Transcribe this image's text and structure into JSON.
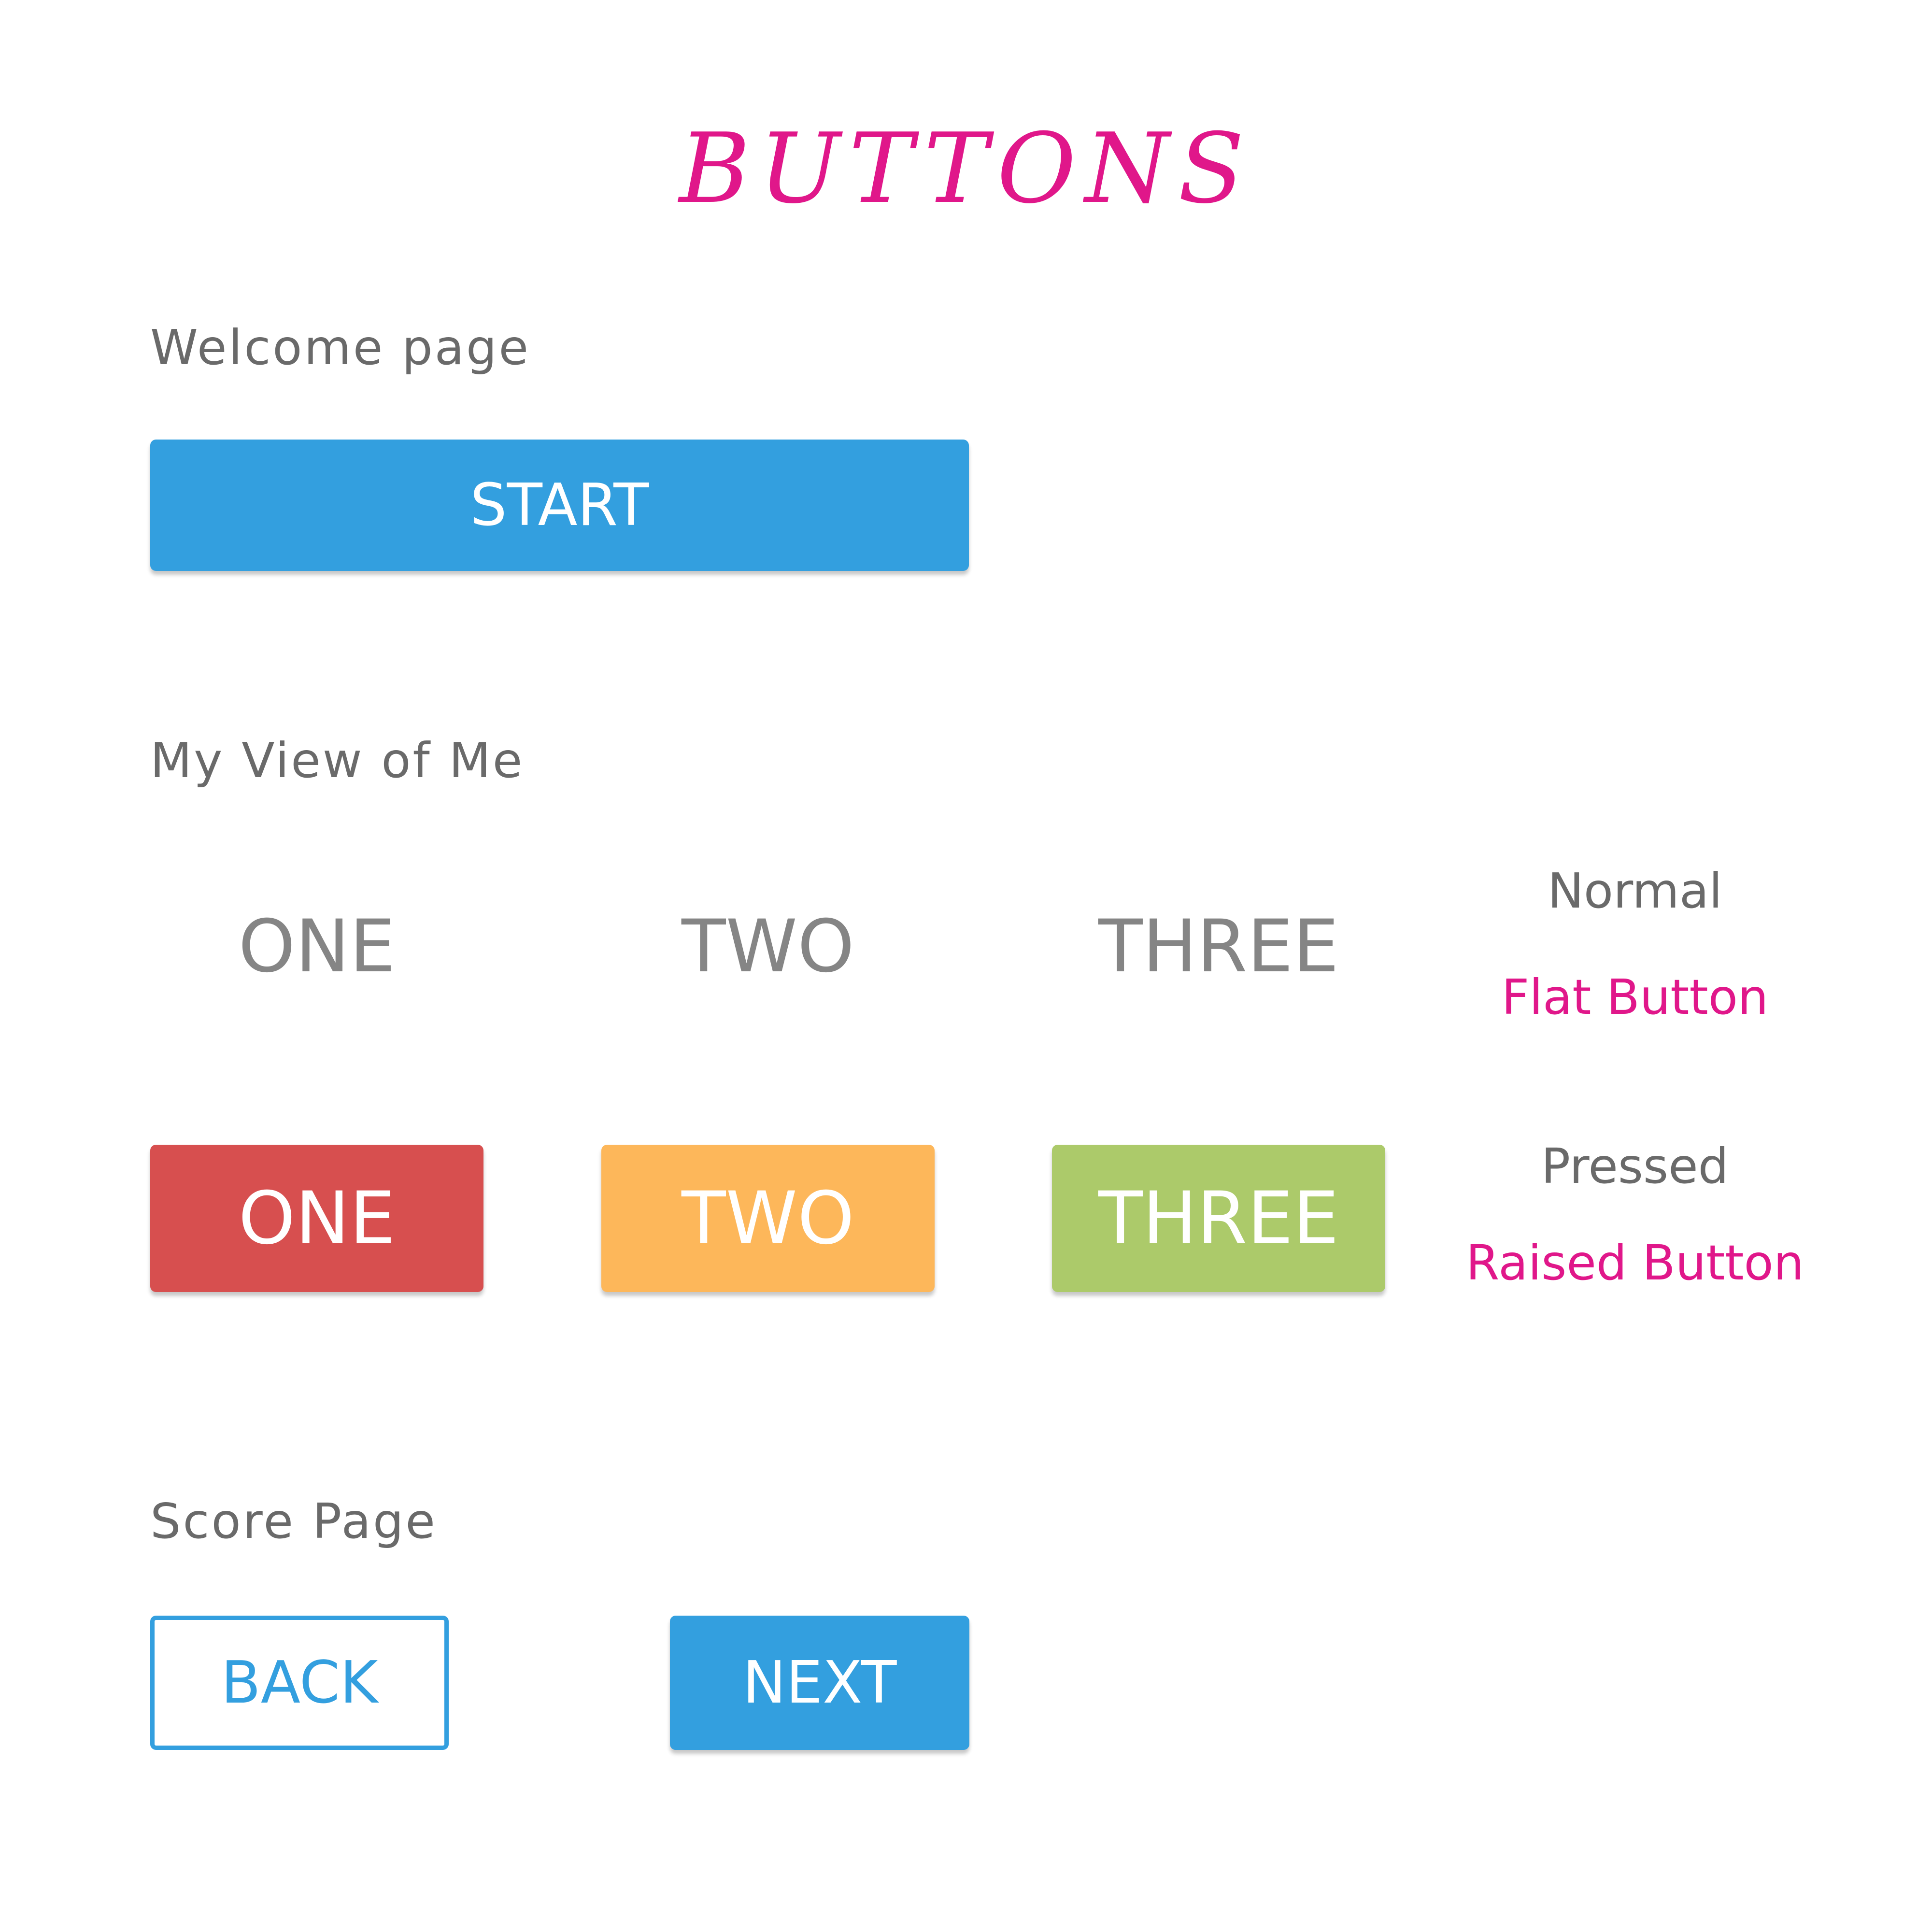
{
  "title": "BUTTONS",
  "welcome": {
    "label": "Welcome page",
    "start_button": "START"
  },
  "my_view": {
    "label": "My View of Me",
    "flat_buttons": [
      "ONE",
      "TWO",
      "THREE"
    ],
    "raised_buttons": [
      {
        "label": "ONE",
        "color": "#d74f4f"
      },
      {
        "label": "TWO",
        "color": "#fdb75a"
      },
      {
        "label": "THREE",
        "color": "#acca6a"
      }
    ],
    "legend": {
      "normal_state": "Normal",
      "normal_type": "Flat Button",
      "pressed_state": "Pressed",
      "pressed_type": "Raised Button"
    }
  },
  "score": {
    "label": "Score Page",
    "back_button": "BACK",
    "next_button": "NEXT"
  },
  "colors": {
    "accent_pink": "#e0178a",
    "primary_blue": "#339fdf",
    "label_gray": "#6a6a6a",
    "flat_text_gray": "#858585"
  }
}
